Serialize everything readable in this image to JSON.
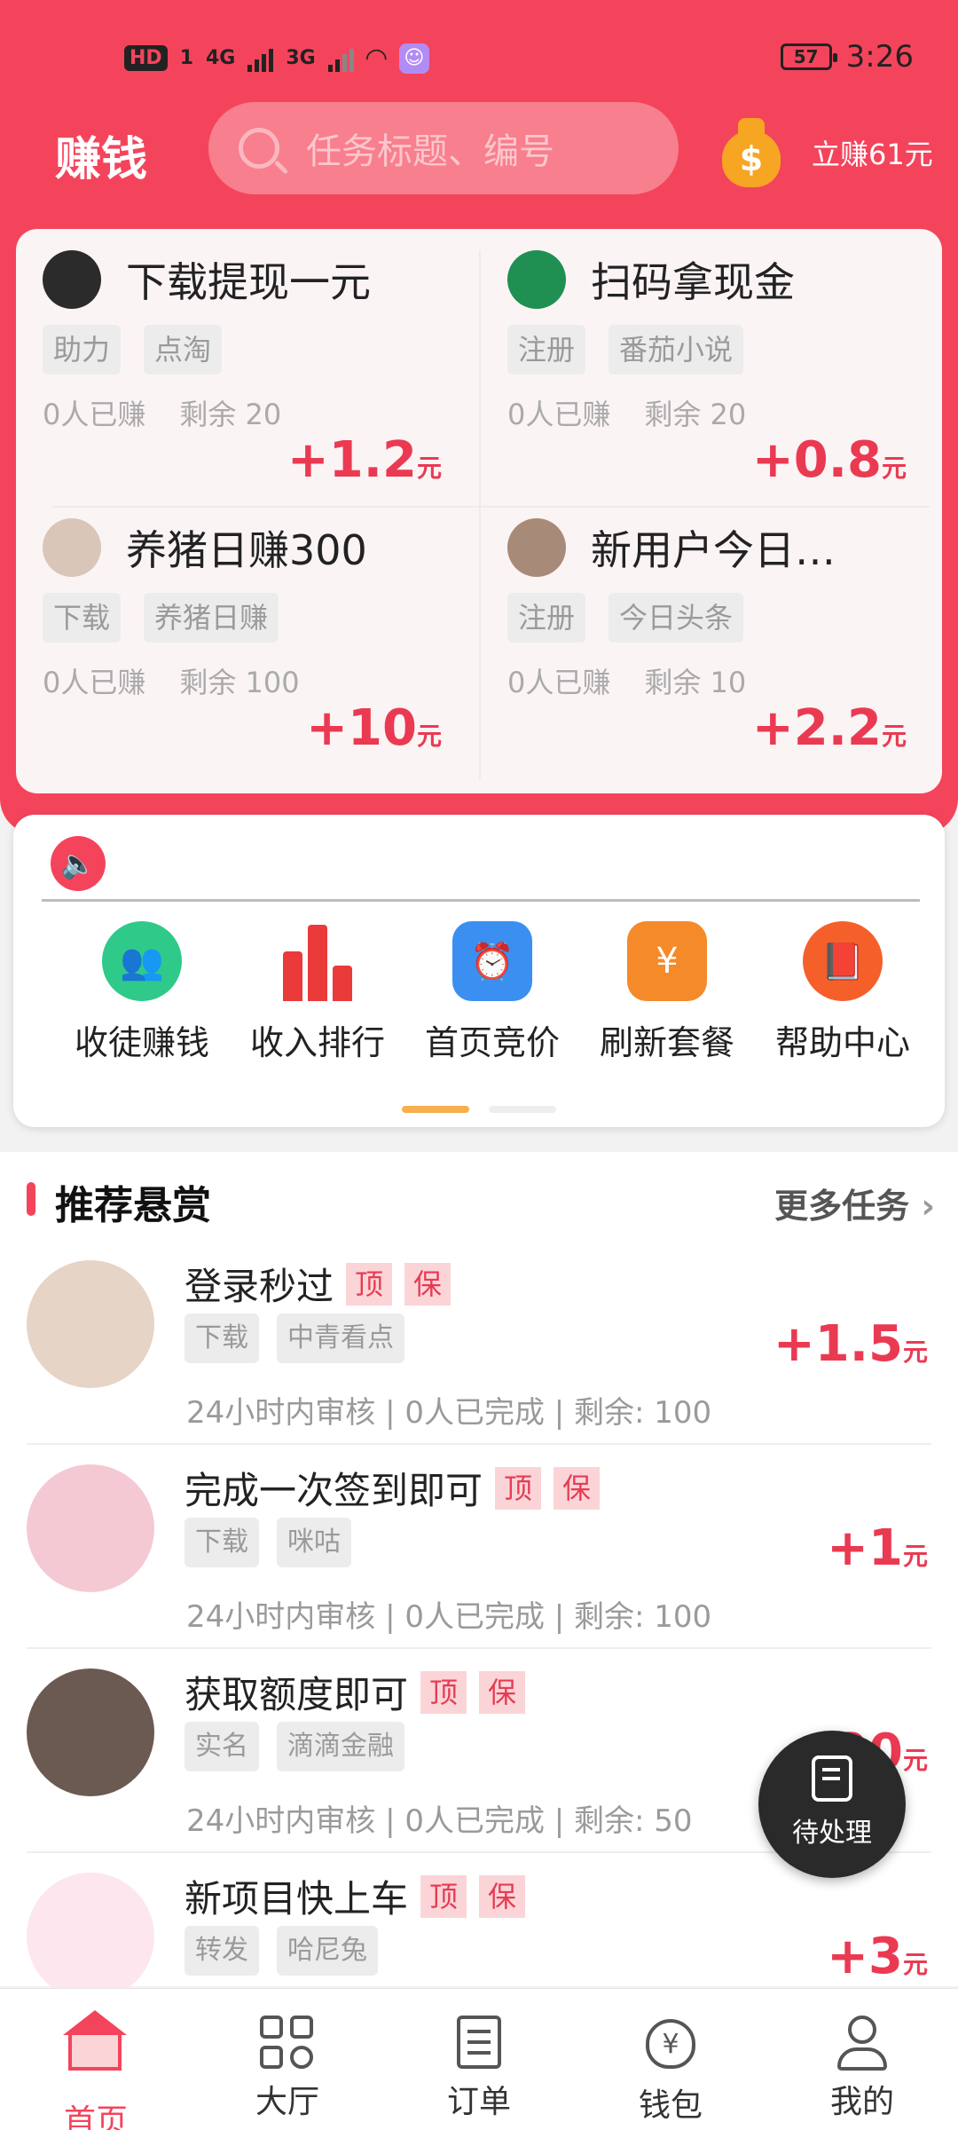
{
  "status_bar": {
    "hd": "HD",
    "sim": "1",
    "net1": "4G",
    "net2": "3G",
    "battery": "57",
    "time": "3:26"
  },
  "header": {
    "title": "赚钱",
    "search_placeholder": "任务标题、编号",
    "earn_now": "立赚61元",
    "coin_symbol": "$"
  },
  "featured": [
    {
      "title": "下载提现一元",
      "tags": [
        "助力",
        "点淘"
      ],
      "earned": "0人已赚",
      "remaining": "剩余 20",
      "price": "+1.2",
      "unit": "元"
    },
    {
      "title": "扫码拿现金",
      "tags": [
        "注册",
        "番茄小说"
      ],
      "earned": "0人已赚",
      "remaining": "剩余 20",
      "price": "+0.8",
      "unit": "元"
    },
    {
      "title": "养猪日赚300",
      "tags": [
        "下载",
        "养猪日赚"
      ],
      "earned": "0人已赚",
      "remaining": "剩余 100",
      "price": "+10",
      "unit": "元"
    },
    {
      "title": "新用户今日…",
      "tags": [
        "注册",
        "今日头条"
      ],
      "earned": "0人已赚",
      "remaining": "剩余 10",
      "price": "+2.2",
      "unit": "元"
    }
  ],
  "menu": [
    {
      "label": "收徒赚钱",
      "icon": "users-icon",
      "color": "#2fc98a"
    },
    {
      "label": "收入排行",
      "icon": "bar-chart-icon",
      "color": "#ea3a3a"
    },
    {
      "label": "首页竞价",
      "icon": "alarm-clock-icon",
      "color": "#3b8ff0"
    },
    {
      "label": "刷新套餐",
      "icon": "yuan-package-icon",
      "color": "#f58a2a"
    },
    {
      "label": "帮助中心",
      "icon": "book-icon",
      "color": "#f5602a"
    }
  ],
  "recommend": {
    "title": "推荐悬赏",
    "more": "更多任务",
    "badge_top": "顶",
    "badge_guarantee": "保",
    "items": [
      {
        "title": "登录秒过",
        "tags": [
          "下载",
          "中青看点"
        ],
        "meta": "24小时内审核 | 0人已完成 | 剩余: 100",
        "price": "+1.5",
        "unit": "元"
      },
      {
        "title": "完成一次签到即可",
        "tags": [
          "下载",
          "咪咕"
        ],
        "meta": "24小时内审核 | 0人已完成 | 剩余: 100",
        "price": "+1",
        "unit": "元"
      },
      {
        "title": "获取额度即可",
        "tags": [
          "实名",
          "滴滴金融"
        ],
        "meta": "24小时内审核 | 0人已完成 | 剩余: 50",
        "price": "+20",
        "unit": "元"
      },
      {
        "title": "新项目快上车",
        "tags": [
          "转发",
          "哈尼兔"
        ],
        "meta": "",
        "price": "+3",
        "unit": "元"
      }
    ]
  },
  "fab": {
    "label": "待处理"
  },
  "nav": [
    {
      "label": "首页",
      "icon": "home-icon",
      "active": true
    },
    {
      "label": "大厅",
      "icon": "grid-search-icon",
      "active": false
    },
    {
      "label": "订单",
      "icon": "order-doc-icon",
      "active": false
    },
    {
      "label": "钱包",
      "icon": "wallet-icon",
      "active": false
    },
    {
      "label": "我的",
      "icon": "user-icon",
      "active": false
    }
  ]
}
